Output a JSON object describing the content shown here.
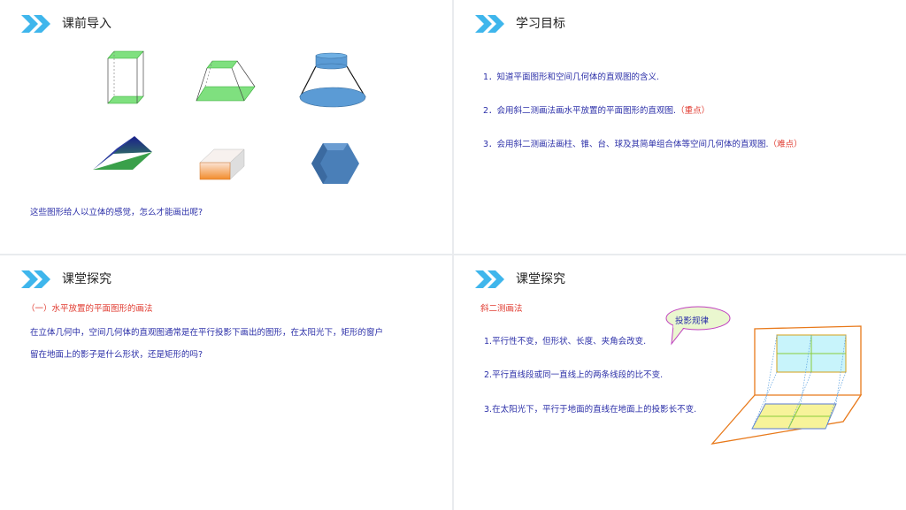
{
  "slide1": {
    "title": "课前导入",
    "question": "这些图形给人以立体的感觉，怎么才能画出呢?"
  },
  "slide2": {
    "title": "学习目标",
    "goals": [
      {
        "text": "1．知道平面图形和空间几何体的直观图的含义.",
        "note": ""
      },
      {
        "text": "2．会用斜二测画法画水平放置的平面图形的直观图.",
        "note": "（重点）"
      },
      {
        "text": "3．会用斜二测画法画柱、锥、台、球及其简单组合体等空间几何体的直观图.",
        "note": "（难点）"
      }
    ]
  },
  "slide3": {
    "title": "课堂探究",
    "subtitle": "（一）水平放置的平面图形的画法",
    "para_line1": "在立体几何中，空间几何体的直观图通常是在平行投影下画出的图形，在太阳光下，矩形的窗户",
    "para_line2": "留在地面上的影子是什么形状，还是矩形的吗?"
  },
  "slide4": {
    "title": "课堂探究",
    "subtitle": "斜二测画法",
    "bubble": "投影规律",
    "rules": [
      "1.平行性不变，但形状、长度、夹角会改变.",
      "2.平行直线段或同一直线上的两条线段的比不变.",
      "3.在太阳光下，平行于地面的直线在地面上的投影长不变."
    ]
  },
  "colors": {
    "chevron": "#3fb6ec",
    "body_text": "#2b2fa8",
    "highlight": "#e03a2f",
    "cyan_window": "#c8f4fb",
    "yellow_shadow": "#f7f39a",
    "orange_frame": "#e8791a"
  }
}
